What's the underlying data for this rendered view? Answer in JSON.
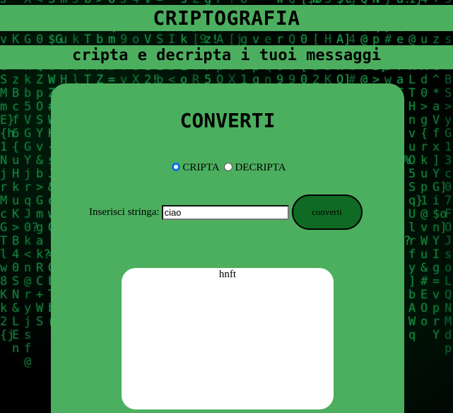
{
  "header": {
    "title": "CRIPTOGRAFIA",
    "subtitle": "cripta e decripta i tuoi messaggi"
  },
  "card": {
    "title": "CONVERTI",
    "modes": [
      {
        "label": "CRIPTA",
        "selected": true
      },
      {
        "label": "DECRIPTA",
        "selected": false
      }
    ],
    "input_label": "Inserisci stringa:",
    "input_value": "ciao",
    "button_label": "converti",
    "output_text": "hnft"
  },
  "colors": {
    "panel_green": "#4caf5f",
    "button_green": "#0f6b23",
    "matrix_text": "#1fae52",
    "radio_selected": "#0a6fe0"
  }
}
